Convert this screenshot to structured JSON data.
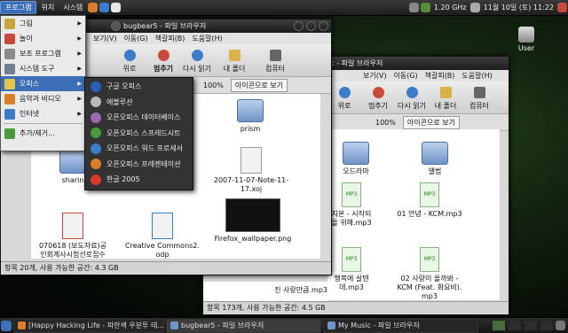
{
  "top_panel": {
    "menus": [
      "프로그램",
      "위치",
      "시스템"
    ],
    "cpu": "1.20 GHz",
    "clock": "11월 10일 (토) 11:22"
  },
  "desktop": {
    "user_icon_label": "User"
  },
  "window_back": {
    "title": "My Music - 파일 브라우저",
    "menus": [
      "music - 파일 브라우저"
    ],
    "menubar": [
      "보기(V)",
      "이동(G)",
      "책갈피(B)",
      "도움말(H)"
    ],
    "toolbar": [
      "위로",
      "멈추기",
      "다시 읽기",
      "내 폴더",
      "컴퓨터"
    ],
    "zoom": "100%",
    "view_mode": "아이콘으로 보기",
    "files": [
      {
        "name": "오드라마",
        "kind": "folder"
      },
      {
        "name": "앨범",
        "kind": "folder"
      },
      {
        "name": "지본 - 시작되\n을 위해.mp3",
        "kind": "mp3"
      },
      {
        "name": "01 안녕 - KCM.mp3",
        "kind": "mp3"
      },
      {
        "name": "행복에 살텐\n데.mp3",
        "kind": "mp3"
      },
      {
        "name": "02 사랑이 올까봐 -\nKCM (Feat. 화요비).\nmp3",
        "kind": "mp3"
      }
    ],
    "partial_file": "진 사랑만큼.mp3",
    "status": "항목 173개, 사용 가능한 공간: 4.5 GB"
  },
  "window_front": {
    "title": "bugbear5 - 파일 브라우저",
    "menubar": [
      "보기(V)",
      "이동(G)",
      "책갈피(B)",
      "도움말(H)"
    ],
    "toolbar": [
      "위로",
      "멈추기",
      "다시 읽기",
      "내 폴더",
      "컴퓨터"
    ],
    "zoom": "100%",
    "view_mode": "아이콘으로 보기",
    "files": [
      {
        "name": "prism",
        "kind": "folder"
      },
      {
        "name": "sharin",
        "kind": "folder"
      },
      {
        "name": "2007-11-07-Note-11-\n17.xoj",
        "kind": "doc"
      },
      {
        "name": "070618 (보도자료)공\n인회계사시험선로접수",
        "kind": "doc"
      },
      {
        "name": "Creative Commons2.\nodp",
        "kind": "doc"
      },
      {
        "name": "Firefox_wallpaper.png",
        "kind": "image"
      }
    ],
    "status": "항목 20개, 사용 가능한 공간: 4.3 GB"
  },
  "apps_menu": {
    "items": [
      {
        "label": "그림",
        "color": "#c9a53c",
        "submenu": true
      },
      {
        "label": "놀이",
        "color": "#c94a3c",
        "submenu": true
      },
      {
        "label": "보조 프로그램",
        "color": "#8a8a8a",
        "submenu": true
      },
      {
        "label": "시스템 도구",
        "color": "#6f7f90",
        "submenu": true
      },
      {
        "label": "오피스",
        "color": "#e6c44a",
        "submenu": true
      },
      {
        "label": "음악과 비디오",
        "color": "#d97f2a",
        "submenu": true
      },
      {
        "label": "인터넷",
        "color": "#3c7cc9",
        "submenu": true
      },
      {
        "label": "추가/제거...",
        "color": "#4a9a3c",
        "submenu": false
      }
    ],
    "highlighted_index": 4
  },
  "office_submenu": {
    "items": [
      {
        "label": "구글 오피스",
        "color": "#2a5fb8"
      },
      {
        "label": "에볼루션",
        "color": "#b8b8b8"
      },
      {
        "label": "오픈오피스 데이터베이스",
        "color": "#9c6ab0"
      },
      {
        "label": "오픈오피스 스프레드시트",
        "color": "#4a9a3c"
      },
      {
        "label": "오픈오피스 워드 프로세서",
        "color": "#3c7cc9"
      },
      {
        "label": "오픈오피스 프레젠테이션",
        "color": "#d97f2a"
      },
      {
        "label": "한글 2005",
        "color": "#d43a2a"
      }
    ]
  },
  "taskbar": {
    "tasks": [
      {
        "label": "[Happy Hacking Life - 파란색 우분투 테...",
        "color": "#d97f2a"
      },
      {
        "label": "bugbear5 - 파일 브라우저",
        "color": "#6f94c8"
      },
      {
        "label": "My Music - 파일 브라우저",
        "color": "#6f94c8"
      }
    ]
  }
}
